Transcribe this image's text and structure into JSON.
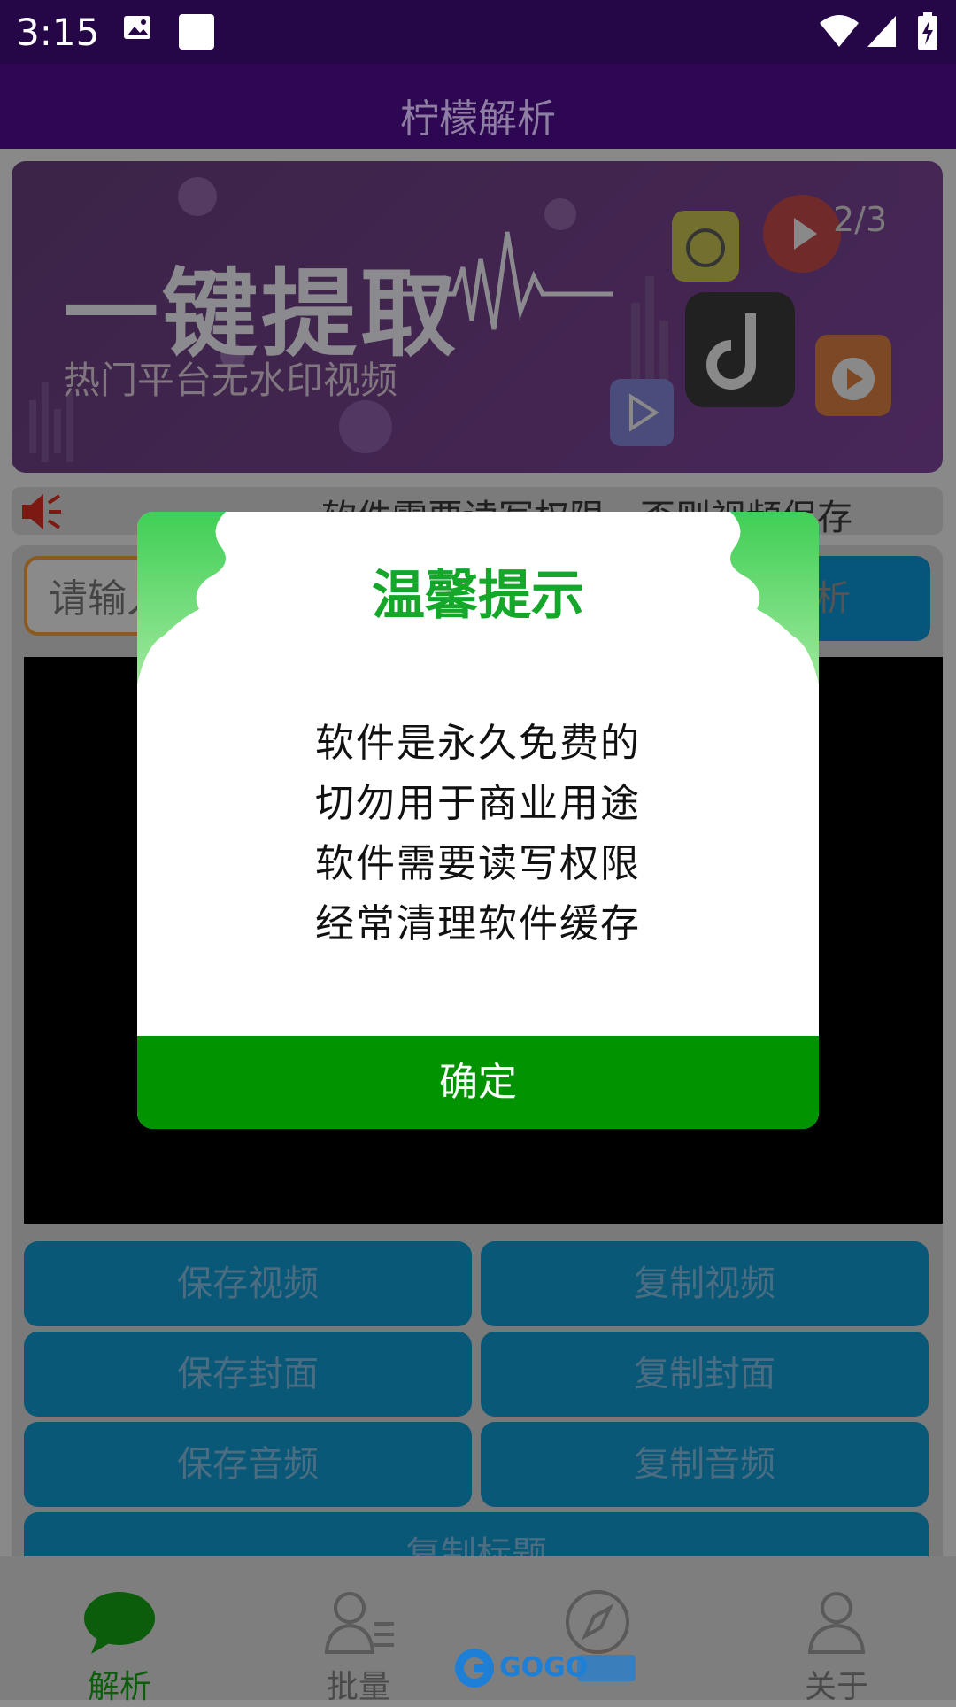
{
  "status_bar": {
    "time": "3:15",
    "icons": [
      "image-icon",
      "square-notification-icon",
      "wifi-icon",
      "signal-icon",
      "battery-charging-icon"
    ]
  },
  "app": {
    "title": "柠檬解析"
  },
  "banner": {
    "headline": "一键提取",
    "subtitle": "热门平台无水印视频",
    "counter": "2/3"
  },
  "notice": {
    "text": "软件需要读写权限，否则视频保存"
  },
  "input": {
    "placeholder": "请输入"
  },
  "parse_button": "解析",
  "actions": {
    "save_video": "保存视频",
    "copy_video": "复制视频",
    "save_cover": "保存封面",
    "copy_cover": "复制封面",
    "save_audio": "保存音频",
    "copy_audio": "复制音频",
    "copy_title": "复制标题"
  },
  "tabs": [
    {
      "label": "解析",
      "icon": "chat-bubble-icon",
      "active": true
    },
    {
      "label": "批量",
      "icon": "user-list-icon",
      "active": false
    },
    {
      "label": "",
      "icon": "compass-icon",
      "active": false
    },
    {
      "label": "关于",
      "icon": "user-icon",
      "active": false
    }
  ],
  "watermark": "GOGO手游网",
  "dialog": {
    "title": "温馨提示",
    "lines": [
      "软件是永久免费的",
      "切勿用于商业用途",
      "软件需要读写权限",
      "经常清理软件缓存"
    ],
    "ok_label": "确定"
  },
  "colors": {
    "status_bar": "#250747",
    "app_bar": "#2d0751",
    "dialog_green": "#019300",
    "dialog_title": "#14a72a",
    "action_button": "#0a5878",
    "tab_active": "#0b5c0b"
  }
}
